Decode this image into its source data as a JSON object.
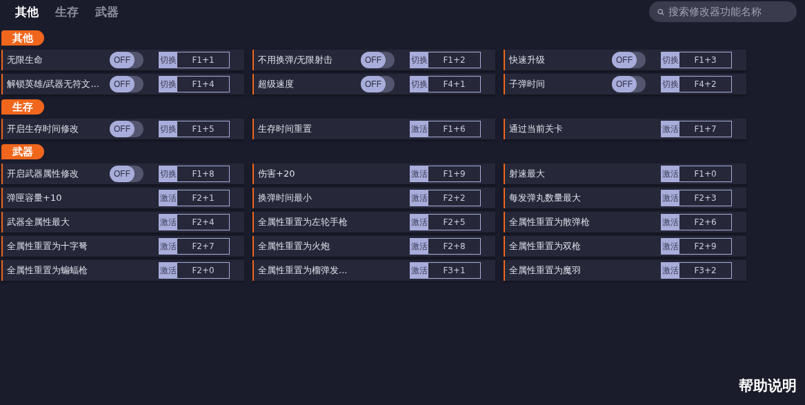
{
  "tabs": [
    {
      "label": "其他",
      "selected": true
    },
    {
      "label": "生存",
      "selected": false
    },
    {
      "label": "武器",
      "selected": false
    }
  ],
  "search": {
    "placeholder": "搜索修改器功能名称"
  },
  "sections": [
    {
      "title": "其他",
      "items": [
        {
          "kind": "toggle",
          "name": "无限生命",
          "toggle_label": "OFF",
          "on": false,
          "action": "切换",
          "hotkey": "F1+1"
        },
        {
          "kind": "toggle",
          "name": "不用换弹/无限射击",
          "toggle_label": "OFF",
          "on": false,
          "action": "切换",
          "hotkey": "F1+2"
        },
        {
          "kind": "toggle",
          "name": "快速升级",
          "toggle_label": "OFF",
          "on": false,
          "action": "切换",
          "hotkey": "F1+3"
        },
        {
          "kind": "toggle",
          "name": "解锁英雄/武器无符文...",
          "toggle_label": "OFF",
          "on": false,
          "action": "切换",
          "hotkey": "F1+4"
        },
        {
          "kind": "toggle",
          "name": "超级速度",
          "toggle_label": "OFF",
          "on": false,
          "action": "切换",
          "hotkey": "F4+1"
        },
        {
          "kind": "toggle",
          "name": "子弹时间",
          "toggle_label": "OFF",
          "on": false,
          "action": "切换",
          "hotkey": "F4+2"
        }
      ]
    },
    {
      "title": "生存",
      "items": [
        {
          "kind": "toggle",
          "name": "开启生存时间修改",
          "toggle_label": "OFF",
          "on": false,
          "action": "切换",
          "hotkey": "F1+5"
        },
        {
          "kind": "button",
          "name": "生存时间重置",
          "action": "激活",
          "hotkey": "F1+6"
        },
        {
          "kind": "button",
          "name": "通过当前关卡",
          "action": "激活",
          "hotkey": "F1+7"
        }
      ]
    },
    {
      "title": "武器",
      "items": [
        {
          "kind": "toggle",
          "name": "开启武器属性修改",
          "toggle_label": "OFF",
          "on": false,
          "action": "切换",
          "hotkey": "F1+8"
        },
        {
          "kind": "button",
          "name": "伤害+20",
          "action": "激活",
          "hotkey": "F1+9"
        },
        {
          "kind": "button",
          "name": "射速最大",
          "action": "激活",
          "hotkey": "F1+0"
        },
        {
          "kind": "button",
          "name": "弹匣容量+10",
          "action": "激活",
          "hotkey": "F2+1"
        },
        {
          "kind": "button",
          "name": "换弹时间最小",
          "action": "激活",
          "hotkey": "F2+2"
        },
        {
          "kind": "button",
          "name": "每发弹丸数量最大",
          "action": "激活",
          "hotkey": "F2+3"
        },
        {
          "kind": "button",
          "name": "武器全属性最大",
          "action": "激活",
          "hotkey": "F2+4"
        },
        {
          "kind": "button",
          "name": "全属性重置为左轮手枪",
          "action": "激活",
          "hotkey": "F2+5"
        },
        {
          "kind": "button",
          "name": "全属性重置为散弹枪",
          "action": "激活",
          "hotkey": "F2+6"
        },
        {
          "kind": "button",
          "name": "全属性重置为十字弩",
          "action": "激活",
          "hotkey": "F2+7"
        },
        {
          "kind": "button",
          "name": "全属性重置为火炮",
          "action": "激活",
          "hotkey": "F2+8"
        },
        {
          "kind": "button",
          "name": "全属性重置为双枪",
          "action": "激活",
          "hotkey": "F2+9"
        },
        {
          "kind": "button",
          "name": "全属性重置为蝙蝠枪",
          "action": "激活",
          "hotkey": "F2+0"
        },
        {
          "kind": "button",
          "name": "全属性重置为榴弹发...",
          "action": "激活",
          "hotkey": "F3+1"
        },
        {
          "kind": "button",
          "name": "全属性重置为魔羽",
          "action": "激活",
          "hotkey": "F3+2"
        }
      ]
    }
  ],
  "help_link": "帮助说明"
}
